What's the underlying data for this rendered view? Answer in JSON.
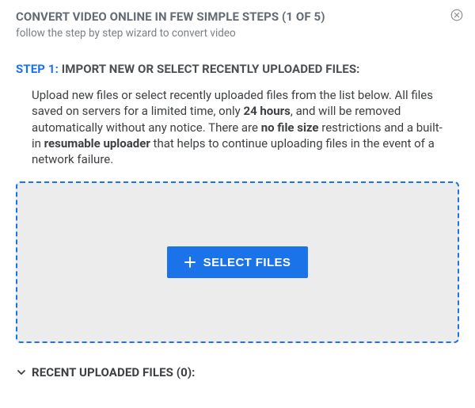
{
  "header": {
    "title": "CONVERT VIDEO ONLINE IN FEW SIMPLE STEPS (1 OF 5)",
    "subtitle": "follow the step by step wizard to convert video"
  },
  "step": {
    "prefix": "STEP 1:",
    "label": " IMPORT NEW OR SELECT RECENTLY UPLOADED FILES:"
  },
  "desc": {
    "t1": "Upload new files or select recently uploaded files from the list below. All files saved on servers for a limited time, only ",
    "b1": "24 hours",
    "t2": ", and will be removed automatically without any notice. There are ",
    "b2": "no file size",
    "t3": " restrictions and a built-in ",
    "b3": "resumable uploader",
    "t4": " that helps to continue uploading files in the event of a network failure."
  },
  "dropzone": {
    "button_label": "SELECT FILES"
  },
  "recent": {
    "label": "RECENT UPLOADED FILES (0):"
  }
}
